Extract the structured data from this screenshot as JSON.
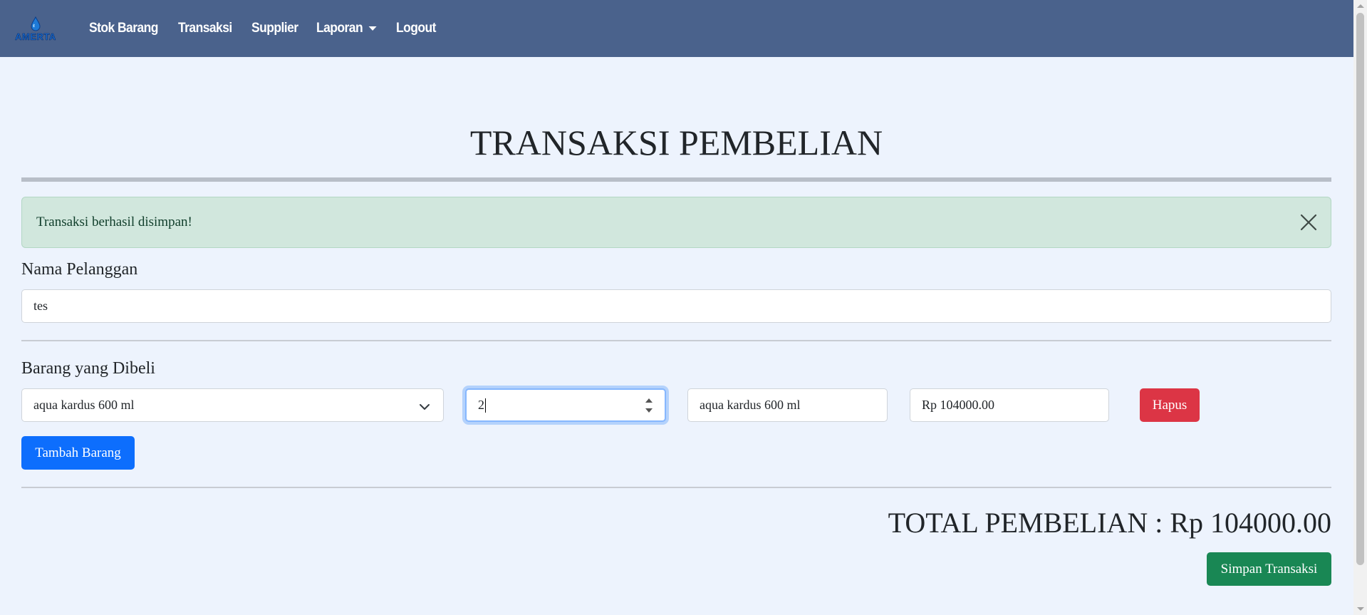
{
  "nav": {
    "brand_text": "AMERTA",
    "items": [
      "Stok Barang",
      "Transaksi",
      "Supplier",
      "Laporan",
      "Logout"
    ]
  },
  "page": {
    "title": "TRANSAKSI PEMBELIAN"
  },
  "alert": {
    "message": "Transaksi berhasil disimpan!"
  },
  "form": {
    "customer_label": "Nama Pelanggan",
    "customer_value": "tes",
    "items_label": "Barang yang Dibeli",
    "item_select_value": "aqua kardus 600 ml",
    "qty_value": "2",
    "item_name_value": "aqua kardus 600 ml",
    "subtotal_value": "Rp 104000.00",
    "delete_label": "Hapus",
    "add_item_label": "Tambah Barang",
    "total_text": "TOTAL PEMBELIAN : Rp 104000.00",
    "save_label": "Simpan Transaksi"
  },
  "colors": {
    "navbar": "#4a628c",
    "background": "#edf3fd",
    "alert_bg": "#d1e7dd",
    "danger": "#dc3545",
    "primary": "#0d6efd",
    "success": "#198754"
  }
}
